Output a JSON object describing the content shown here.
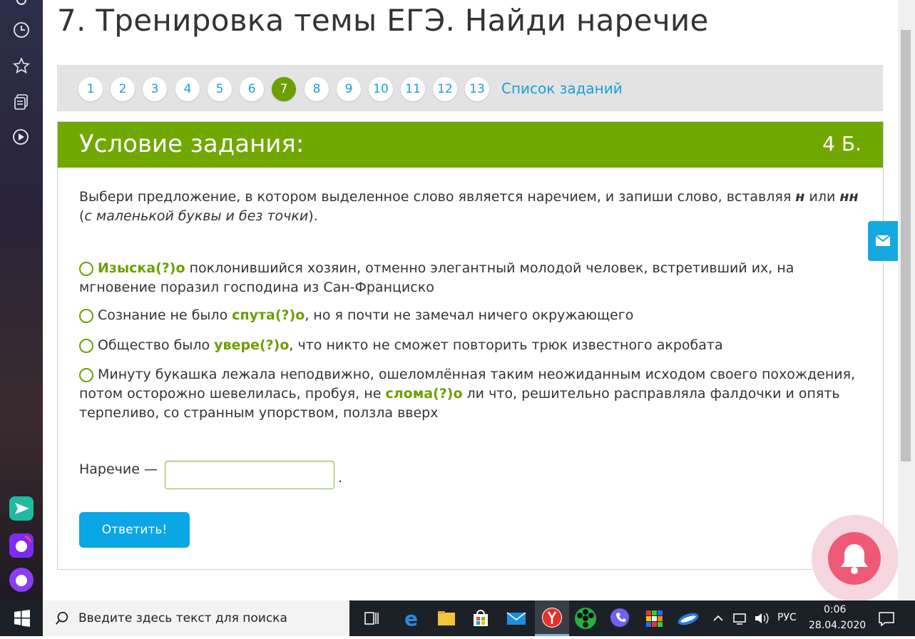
{
  "page": {
    "title": "7. Тренировка темы ЕГЭ. Найди наречие"
  },
  "pager": {
    "numbers": [
      "1",
      "2",
      "3",
      "4",
      "5",
      "6",
      "7",
      "8",
      "9",
      "10",
      "11",
      "12",
      "13"
    ],
    "active": "7",
    "list_link": "Список заданий"
  },
  "task": {
    "header": "Условие задания:",
    "points": "4 Б.",
    "instruction_pre": "Выбери предложение, в котором выделенное слово является наречием, и запиши слово, вставляя ",
    "instruction_n": "н",
    "instruction_or": " или ",
    "instruction_nn": "нн",
    "instruction_open": " (",
    "instruction_italic": "с маленькой буквы и без точки",
    "instruction_close": ").",
    "options": [
      {
        "before": "",
        "highlight": "Изыска(?)о",
        "after": " поклонившийся хозяин, отменно элегантный молодой человек, встретивший их, на мгновение поразил господина из Сан-Франциско"
      },
      {
        "before": "Сознание не было ",
        "highlight": "спута(?)о",
        "after": ", но я почти не замечал ничего окружающего"
      },
      {
        "before": "Общество было ",
        "highlight": "увере(?)о",
        "after": ", что никто не сможет повторить трюк известного акробата"
      },
      {
        "before": "Минуту букашка лежала неподвижно, ошеломлённая таким неожиданным исходом своего похождения, потом осторожно шевелилась, пробуя, не ",
        "highlight": "слома(?)о",
        "after": " ли что, решительно расправляла фалдочки и опять терпеливо, со странным упорством, ползла вверх"
      }
    ],
    "answer_label": "Наречие —",
    "answer_value": "",
    "answer_dot": ".",
    "submit_label": "Ответить!"
  },
  "taskbar": {
    "search_placeholder": "Введите здесь текст для поиска",
    "language": "РУС",
    "time": "0:06",
    "date": "28.04.2020"
  },
  "colors": {
    "accent_green": "#71a800",
    "link_blue": "#1a9fd8",
    "button_blue": "#0aa6e6",
    "bell_pink": "#ee5a76"
  }
}
